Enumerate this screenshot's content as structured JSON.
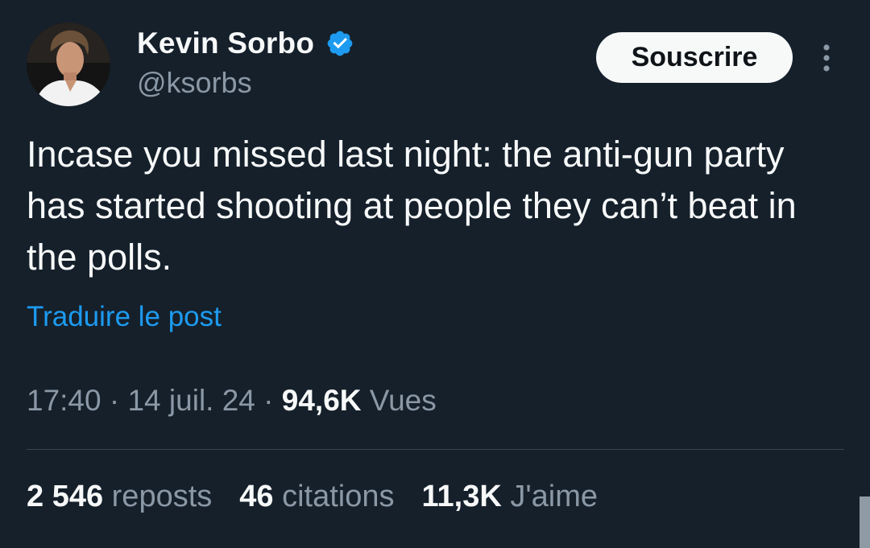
{
  "author": {
    "display_name": "Kevin Sorbo",
    "handle": "@ksorbs",
    "verified": true
  },
  "actions": {
    "subscribe_label": "Souscrire"
  },
  "tweet": {
    "text": "Incase you missed last night: the anti-gun party has started shooting at people they can’t beat in the polls.",
    "translate_label": "Traduire le post"
  },
  "meta": {
    "time": "17:40",
    "separator1": " · ",
    "date": "14 juil. 24",
    "separator2": " · ",
    "views_count": "94,6K",
    "views_label": " Vues"
  },
  "stats": {
    "reposts_count": "2 546",
    "reposts_label": " reposts",
    "quotes_count": "46",
    "quotes_label": " citations",
    "likes_count": "11,3K",
    "likes_label": " J'aime"
  },
  "colors": {
    "background": "#15202b",
    "accent": "#1d9bf0",
    "text": "#f7f9f9",
    "muted": "#8b98a5"
  },
  "icons": {
    "verified": "verified-badge-icon",
    "more": "more-dots-icon"
  }
}
